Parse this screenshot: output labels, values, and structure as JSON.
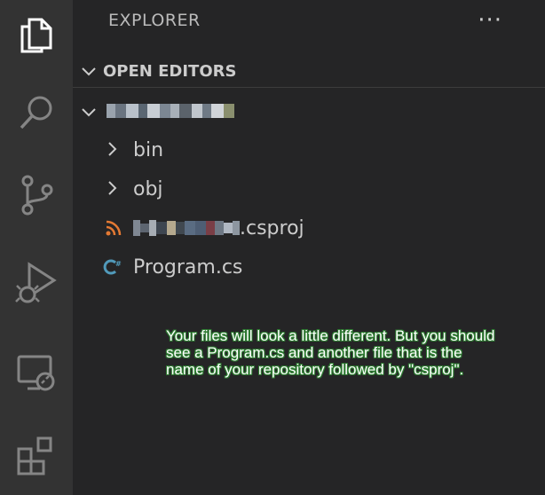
{
  "sidebar": {
    "header": "EXPLORER",
    "more_label": "···",
    "open_editors_label": "OPEN EDITORS"
  },
  "tree": {
    "items": [
      {
        "label": "bin"
      },
      {
        "label": "obj"
      },
      {
        "label": ".csproj"
      },
      {
        "label": "Program.cs"
      }
    ]
  },
  "annotation": {
    "text": "Your files will look a little different. But you should see a Program.cs and another file that is the name of your repository followed by \"csproj\"."
  },
  "colors": {
    "activity_bar": "#333333",
    "sidebar": "#252526",
    "text": "#cccccc",
    "rss_icon": "#e37933",
    "csharp_icon": "#519aba",
    "annotation_outline": "#2e7d32"
  },
  "icons": [
    "files-icon",
    "search-icon",
    "source-control-icon",
    "run-debug-icon",
    "remote-explorer-icon",
    "extensions-icon",
    "chevron-down-icon",
    "chevron-right-icon",
    "rss-icon",
    "csharp-icon",
    "more-icon"
  ]
}
